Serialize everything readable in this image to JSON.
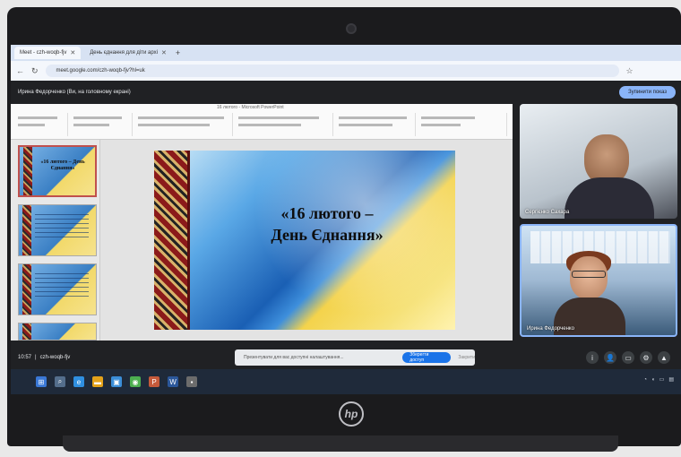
{
  "browser": {
    "tabs": [
      {
        "label": "Meet - czh-woqb-fjv",
        "active": true
      },
      {
        "label": "День єднання для діти архі",
        "active": false
      }
    ],
    "new_tab_symbol": "+",
    "url": "meet.google.com/czh-woqb-fjv?hl=uk"
  },
  "meet": {
    "presenting_text": "Ирина Федорченко (Ви, на головному екрані)",
    "stop_presenting_label": "Зупинити показ",
    "meeting_time": "10:57",
    "meeting_code": "czh-woqb-fjv",
    "toast": {
      "text": "Презентувати для вас доступні налаштування...",
      "button_label": "Зберегти доступ",
      "close_label": "Закрити"
    },
    "participants": [
      {
        "name": "Сергієнко Сахара"
      },
      {
        "name": "Ирина Федорченко"
      }
    ]
  },
  "powerpoint": {
    "window_title": "16 лютого - Microsoft PowerPoint",
    "thumbnails": [
      {
        "text": "«16 лютого – День Єднання»",
        "active": true
      },
      {
        "text": "",
        "active": false
      },
      {
        "text": "",
        "active": false
      }
    ],
    "slide": {
      "title_line1": "«16 лютого –",
      "title_line2": "День Єднання»"
    }
  },
  "device": {
    "logo": "hp"
  },
  "colors": {
    "accent": "#8ab4f8",
    "meet_background": "#202124",
    "ornament_red": "#8b1a1a"
  }
}
